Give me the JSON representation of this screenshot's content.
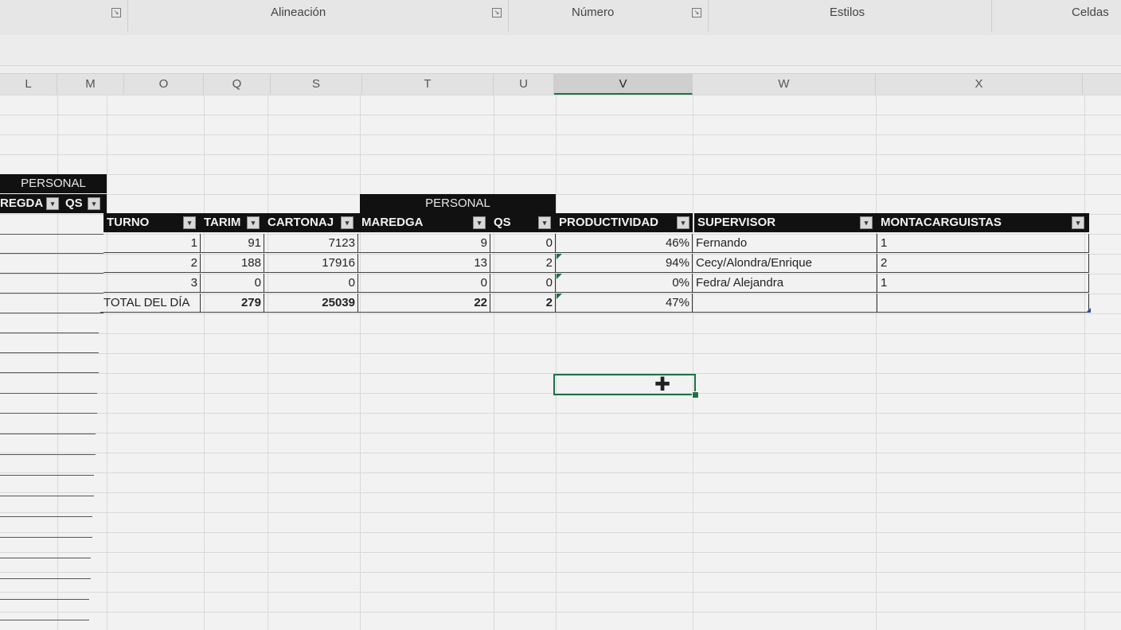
{
  "ribbon": {
    "groups": [
      "Alineación",
      "Número",
      "Estilos",
      "Celdas"
    ]
  },
  "columns": [
    "L",
    "M",
    "O",
    "Q",
    "S",
    "T",
    "U",
    "V",
    "W",
    "X"
  ],
  "left_table": {
    "title": "PERSONAL",
    "headers": [
      "REGDA",
      "QS"
    ]
  },
  "table": {
    "group_title": "PERSONAL",
    "headers": [
      "TURNO",
      "TARIM",
      "CARTONAJ",
      "MAREDGA",
      "QS",
      "PRODUCTIVIDAD",
      "SUPERVISOR",
      "MONTACARGUISTAS"
    ],
    "rows": [
      [
        "1",
        "91",
        "7123",
        "9",
        "0",
        "46%",
        "Fernando",
        "1"
      ],
      [
        "2",
        "188",
        "17916",
        "13",
        "2",
        "94%",
        "Cecy/Alondra/Enrique",
        "2"
      ],
      [
        "3",
        "0",
        "0",
        "0",
        "0",
        "0%",
        "Fedra/ Alejandra",
        "1"
      ]
    ],
    "total": [
      "TOTAL DEL DÍA",
      "279",
      "25039",
      "22",
      "2",
      "47%",
      "",
      ""
    ]
  },
  "colors": {
    "header_bg": "#111111",
    "selection": "#1e7145"
  }
}
